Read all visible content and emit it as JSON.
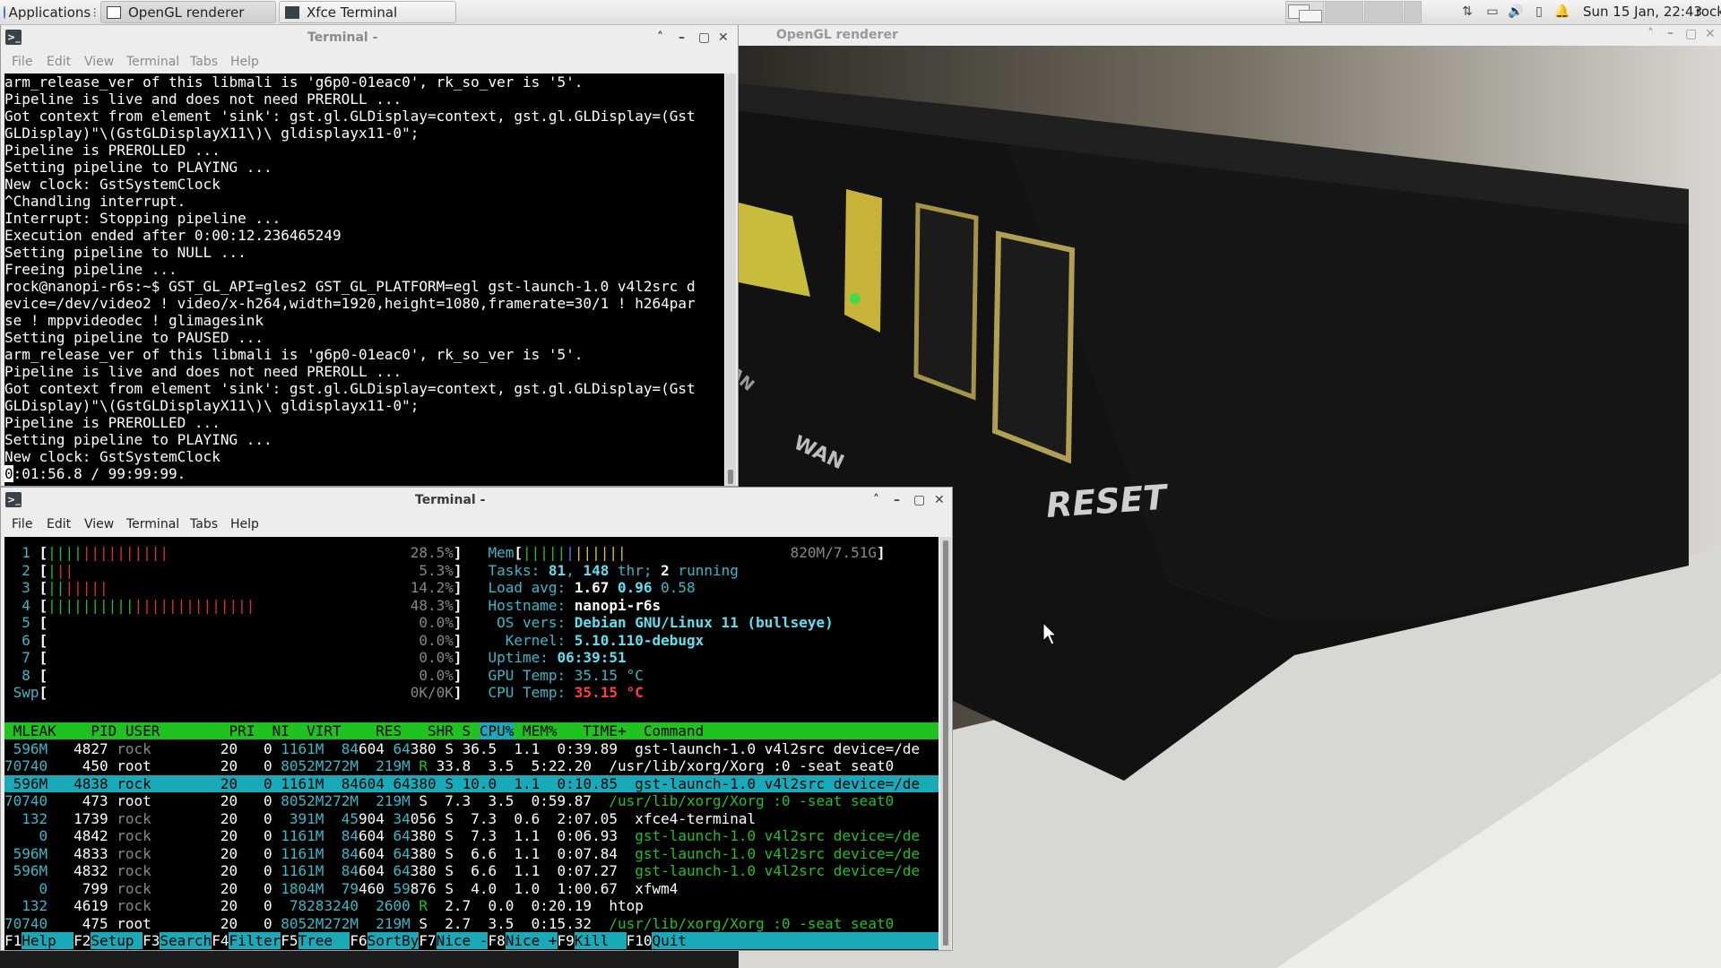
{
  "panel": {
    "applications_label": "Applications",
    "tasks": [
      {
        "label": "OpenGL renderer",
        "active": true
      },
      {
        "label": "Xfce Terminal",
        "active": false
      }
    ],
    "clock": "Sun 15 Jan, 22:43",
    "user": "rock"
  },
  "renderer": {
    "title": "OpenGL renderer",
    "photo_text_reset": "RESET",
    "photo_text_wan": "WAN",
    "photo_text_lan": "LAN"
  },
  "terminal1": {
    "title": "Terminal -",
    "menu": [
      "File",
      "Edit",
      "View",
      "Terminal",
      "Tabs",
      "Help"
    ],
    "lines": [
      "arm_release_ver of this libmali is 'g6p0-01eac0', rk_so_ver is '5'.",
      "Pipeline is live and does not need PREROLL ...",
      "Got context from element 'sink': gst.gl.GLDisplay=context, gst.gl.GLDisplay=(Gst",
      "GLDisplay)\"\\(GstGLDisplayX11\\)\\ gldisplayx11-0\";",
      "Pipeline is PREROLLED ...",
      "Setting pipeline to PLAYING ...",
      "New clock: GstSystemClock",
      "^Chandling interrupt.",
      "Interrupt: Stopping pipeline ...",
      "Execution ended after 0:00:12.236465249",
      "Setting pipeline to NULL ...",
      "Freeing pipeline ...",
      "rock@nanopi-r6s:~$ GST_GL_API=gles2 GST_GL_PLATFORM=egl gst-launch-1.0 v4l2src d",
      "evice=/dev/video2 ! video/x-h264,width=1920,height=1080,framerate=30/1 ! h264par",
      "se ! mppvideodec ! glimagesink",
      "Setting pipeline to PAUSED ...",
      "arm_release_ver of this libmali is 'g6p0-01eac0', rk_so_ver is '5'.",
      "Pipeline is live and does not need PREROLL ...",
      "Got context from element 'sink': gst.gl.GLDisplay=context, gst.gl.GLDisplay=(Gst",
      "GLDisplay)\"\\(GstGLDisplayX11\\)\\ gldisplayx11-0\";",
      "Pipeline is PREROLLED ...",
      "Setting pipeline to PLAYING ...",
      "New clock: GstSystemClock"
    ],
    "last_line_cursor_char": "0",
    "last_line_rest": ":01:56.8 / 99:99:99."
  },
  "terminal2": {
    "title": "Terminal -",
    "menu": [
      "File",
      "Edit",
      "View",
      "Terminal",
      "Tabs",
      "Help"
    ]
  },
  "htop": {
    "cpus": [
      {
        "label": "1",
        "pct": "28.5%",
        "green": 4,
        "red": 10
      },
      {
        "label": "2",
        "pct": "5.3%",
        "green": 1,
        "red": 2
      },
      {
        "label": "3",
        "pct": "14.2%",
        "green": 2,
        "red": 5
      },
      {
        "label": "4",
        "pct": "48.3%",
        "green": 10,
        "red": 14
      },
      {
        "label": "5",
        "pct": "0.0%",
        "green": 0,
        "red": 0
      },
      {
        "label": "6",
        "pct": "0.0%",
        "green": 0,
        "red": 0
      },
      {
        "label": "7",
        "pct": "0.0%",
        "green": 0,
        "red": 0
      },
      {
        "label": "8",
        "pct": "0.0%",
        "green": 0,
        "red": 0
      }
    ],
    "swap": {
      "label": "Swp",
      "value": "0K/0K"
    },
    "mem": {
      "label": "Mem",
      "value": "820M/7.51G"
    },
    "tasks": {
      "label": "Tasks:",
      "count": "81",
      "threads": "148",
      "thr_label": "thr;",
      "running": "2",
      "running_label": "running"
    },
    "load": {
      "label": "Load avg:",
      "v1": "1.67",
      "v2": "0.96",
      "v3": "0.58"
    },
    "hostname": {
      "label": "Hostname:",
      "value": "nanopi-r6s"
    },
    "os": {
      "label": "OS vers:",
      "value": "Debian GNU/Linux 11 (bullseye)"
    },
    "kernel": {
      "label": "Kernel:",
      "value": "5.10.110-debugx"
    },
    "uptime": {
      "label": "Uptime:",
      "value": "06:39:51"
    },
    "gpu_temp": {
      "label": "GPU Temp:",
      "value": "35.15 °C"
    },
    "cpu_temp": {
      "label": "CPU Temp:",
      "value": "35.15 °C"
    },
    "columns": [
      "MLEAK",
      "PID",
      "USER",
      "PRI",
      "NI",
      "VIRT",
      "RES",
      "SHR",
      "S",
      "CPU%",
      "MEM%",
      "TIME+",
      "Command"
    ],
    "processes": [
      {
        "mleak": "596M",
        "pid": "4827",
        "user": "rock",
        "pri": "20",
        "ni": "0",
        "virt": "1161M",
        "res": "84604",
        "shr": "64380",
        "s": "S",
        "cpu": "36.5",
        "mem": "1.1",
        "time": "0:39.89",
        "cmd": "gst-launch-1.0 v4l2src device=/de",
        "thread": false,
        "selected": false
      },
      {
        "mleak": "70740",
        "pid": "450",
        "user": "root",
        "pri": "20",
        "ni": "0",
        "virt": "8052M",
        "res": "272M",
        "shr": "219M",
        "s": "R",
        "cpu": "33.8",
        "mem": "3.5",
        "time": "5:22.20",
        "cmd": "/usr/lib/xorg/Xorg :0 -seat seat0",
        "thread": false,
        "selected": false
      },
      {
        "mleak": "596M",
        "pid": "4838",
        "user": "rock",
        "pri": "20",
        "ni": "0",
        "virt": "1161M",
        "res": "84604",
        "shr": "64380",
        "s": "S",
        "cpu": "10.0",
        "mem": "1.1",
        "time": "0:10.85",
        "cmd": "gst-launch-1.0 v4l2src device=/de",
        "thread": true,
        "selected": true
      },
      {
        "mleak": "70740",
        "pid": "473",
        "user": "root",
        "pri": "20",
        "ni": "0",
        "virt": "8052M",
        "res": "272M",
        "shr": "219M",
        "s": "S",
        "cpu": "7.3",
        "mem": "3.5",
        "time": "0:59.87",
        "cmd": "/usr/lib/xorg/Xorg :0 -seat seat0",
        "thread": true,
        "selected": false
      },
      {
        "mleak": "132",
        "pid": "1739",
        "user": "rock",
        "pri": "20",
        "ni": "0",
        "virt": "391M",
        "res": "45904",
        "shr": "34056",
        "s": "S",
        "cpu": "7.3",
        "mem": "0.6",
        "time": "2:07.05",
        "cmd": "xfce4-terminal",
        "thread": false,
        "selected": false
      },
      {
        "mleak": "0",
        "pid": "4842",
        "user": "rock",
        "pri": "20",
        "ni": "0",
        "virt": "1161M",
        "res": "84604",
        "shr": "64380",
        "s": "S",
        "cpu": "7.3",
        "mem": "1.1",
        "time": "0:06.93",
        "cmd": "gst-launch-1.0 v4l2src device=/de",
        "thread": true,
        "selected": false
      },
      {
        "mleak": "596M",
        "pid": "4833",
        "user": "rock",
        "pri": "20",
        "ni": "0",
        "virt": "1161M",
        "res": "84604",
        "shr": "64380",
        "s": "S",
        "cpu": "6.6",
        "mem": "1.1",
        "time": "0:07.84",
        "cmd": "gst-launch-1.0 v4l2src device=/de",
        "thread": true,
        "selected": false
      },
      {
        "mleak": "596M",
        "pid": "4832",
        "user": "rock",
        "pri": "20",
        "ni": "0",
        "virt": "1161M",
        "res": "84604",
        "shr": "64380",
        "s": "S",
        "cpu": "6.6",
        "mem": "1.1",
        "time": "0:07.27",
        "cmd": "gst-launch-1.0 v4l2src device=/de",
        "thread": true,
        "selected": false
      },
      {
        "mleak": "0",
        "pid": "799",
        "user": "rock",
        "pri": "20",
        "ni": "0",
        "virt": "1804M",
        "res": "79460",
        "shr": "59876",
        "s": "S",
        "cpu": "4.0",
        "mem": "1.0",
        "time": "1:00.67",
        "cmd": "xfwm4",
        "thread": false,
        "selected": false
      },
      {
        "mleak": "132",
        "pid": "4619",
        "user": "rock",
        "pri": "20",
        "ni": "0",
        "virt": "7828",
        "res": "3240",
        "shr": "2600",
        "s": "R",
        "cpu": "2.7",
        "mem": "0.0",
        "time": "0:20.19",
        "cmd": "htop",
        "thread": false,
        "selected": false
      },
      {
        "mleak": "70740",
        "pid": "475",
        "user": "root",
        "pri": "20",
        "ni": "0",
        "virt": "8052M",
        "res": "272M",
        "shr": "219M",
        "s": "S",
        "cpu": "2.7",
        "mem": "3.5",
        "time": "0:15.32",
        "cmd": "/usr/lib/xorg/Xorg :0 -seat seat0",
        "thread": true,
        "selected": false
      }
    ],
    "fkeys": [
      {
        "key": "F1",
        "label": "Help  "
      },
      {
        "key": "F2",
        "label": "Setup "
      },
      {
        "key": "F3",
        "label": "Search"
      },
      {
        "key": "F4",
        "label": "Filter"
      },
      {
        "key": "F5",
        "label": "Tree  "
      },
      {
        "key": "F6",
        "label": "SortBy"
      },
      {
        "key": "F7",
        "label": "Nice -"
      },
      {
        "key": "F8",
        "label": "Nice +"
      },
      {
        "key": "F9",
        "label": "Kill  "
      },
      {
        "key": "F10",
        "label": "Quit"
      }
    ]
  },
  "colors": {
    "htop_header_bg": "#1fc21f",
    "htop_select_bg": "#18aab8",
    "cpu_temp_red": "#ff4040"
  }
}
